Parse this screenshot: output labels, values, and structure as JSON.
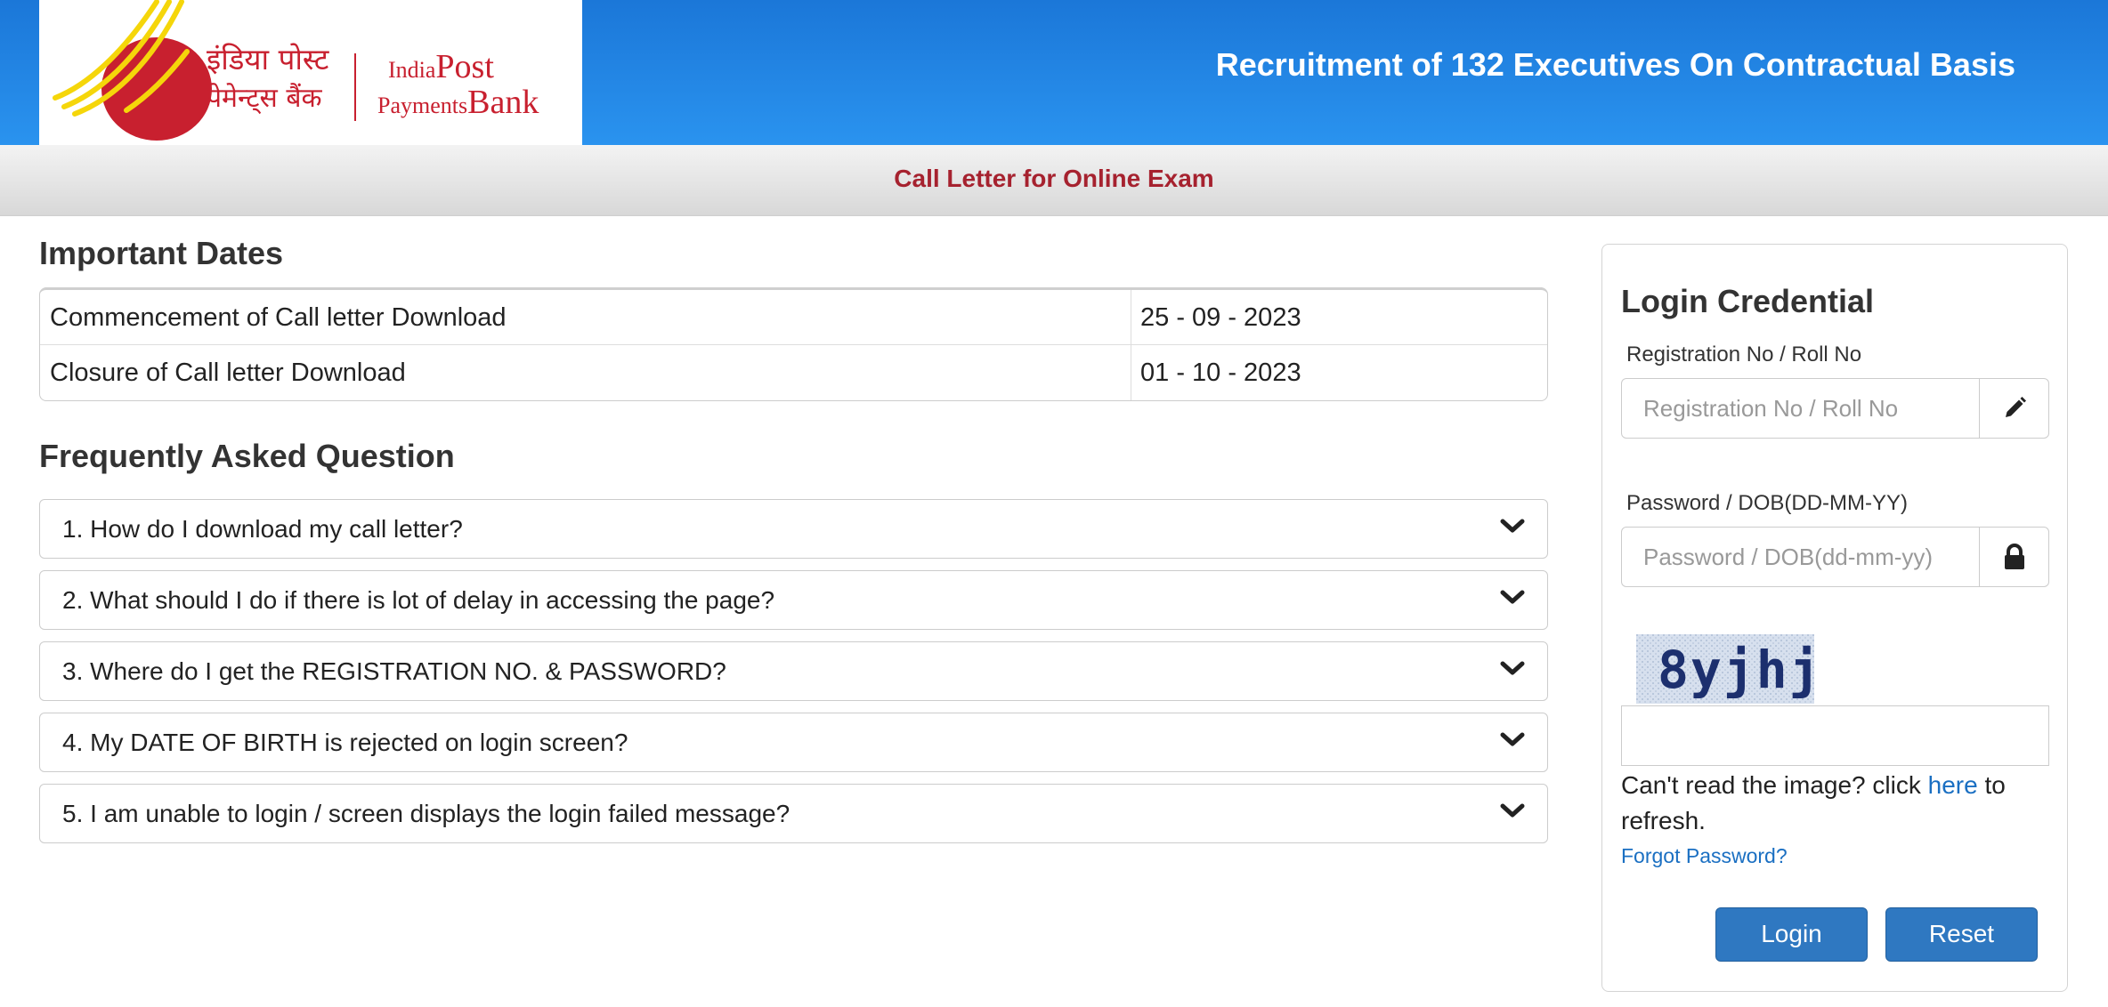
{
  "header": {
    "logo": {
      "hindi_line1": "इंडिया पोस्ट",
      "hindi_line2": "पेमेन्ट्स बैंक",
      "english_line1_a": "India",
      "english_line1_b": "Post",
      "english_line2_a": "Payments",
      "english_line2_b": "Bank",
      "brand_color": "#c8202f",
      "swoosh_color": "#f5d60a"
    },
    "title": "Recruitment of 132 Executives On Contractual Basis",
    "color": "#1b77d8"
  },
  "subbar": {
    "title": "Call Letter for Online Exam",
    "title_color": "#a6222f"
  },
  "important_dates": {
    "heading": "Important Dates",
    "rows": [
      {
        "label": "Commencement of Call letter Download",
        "date": "25 - 09 - 2023"
      },
      {
        "label": "Closure of Call letter Download",
        "date": "01 - 10 - 2023"
      }
    ]
  },
  "faq": {
    "heading": "Frequently Asked Question",
    "items": [
      {
        "question": "1. How do I download my call letter?",
        "icon": "chevron-down-icon"
      },
      {
        "question": "2. What should I do if there is lot of delay in accessing the page?",
        "icon": "chevron-down-icon"
      },
      {
        "question": "3. Where do I get the REGISTRATION NO. & PASSWORD?",
        "icon": "chevron-down-icon"
      },
      {
        "question": "4. My DATE OF BIRTH is rejected on login screen?",
        "icon": "chevron-down-icon"
      },
      {
        "question": "5. I am unable to login / screen displays the login failed message?",
        "icon": "chevron-down-icon"
      }
    ]
  },
  "login": {
    "title": "Login Credential",
    "registration": {
      "label": "Registration No / Roll No",
      "placeholder": "Registration No / Roll No",
      "value": "",
      "icon": "pencil-icon"
    },
    "password": {
      "label": "Password / DOB(DD-MM-YY)",
      "placeholder": "Password / DOB(dd-mm-yy)",
      "value": "",
      "icon": "lock-icon"
    },
    "captcha": {
      "text": "8yjhj",
      "input_value": ""
    },
    "refresh_prefix": "Can't read the image? click ",
    "refresh_link": "here",
    "refresh_suffix": " to refresh.",
    "forgot_password": "Forgot Password?",
    "login_button": "Login",
    "reset_button": "Reset",
    "button_color": "#2f78c1",
    "link_color": "#1a6fc2"
  }
}
